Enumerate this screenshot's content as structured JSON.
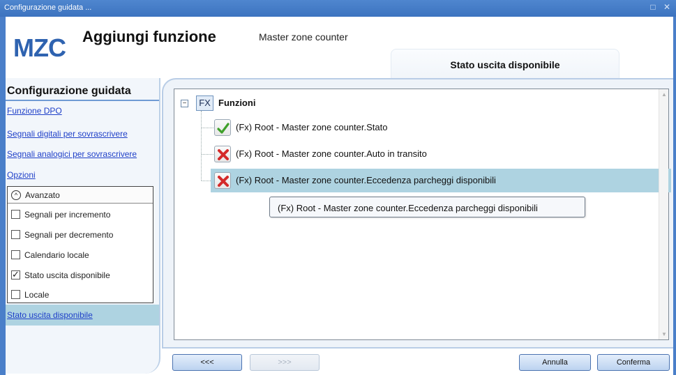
{
  "window": {
    "title": "Configurazione guidata ...",
    "controls": "□ ✕"
  },
  "header": {
    "logo": "MZC",
    "title": "Aggiungi funzione",
    "subtitle": "Master zone counter",
    "active_tab": "Stato uscita disponibile"
  },
  "sidebar": {
    "heading": "Configurazione guidata",
    "links": [
      "Funzione DPO",
      "Segnali digitali per sovrascrivere",
      "Segnali analogici per sovrascrivere",
      "Opzioni"
    ],
    "advanced": {
      "label": "Avanzato",
      "items": [
        {
          "label": "Segnali per incremento",
          "checked": false
        },
        {
          "label": "Segnali per decremento",
          "checked": false
        },
        {
          "label": "Calendario locale",
          "checked": false
        },
        {
          "label": "Stato uscita disponibile",
          "checked": true
        },
        {
          "label": "Locale",
          "checked": false
        }
      ]
    },
    "selected_link": "Stato uscita disponibile"
  },
  "tree": {
    "root_badge": "FX",
    "root_label": "Funzioni",
    "rows": [
      {
        "label": "(Fx) Root - Master zone counter.Stato",
        "status": "check-icon"
      },
      {
        "label": "(Fx) Root - Master zone counter.Auto in transito",
        "status": "cross-icon"
      },
      {
        "label": "(Fx) Root - Master zone counter.Eccedenza parcheggi disponibili",
        "status": "cross-icon"
      }
    ],
    "tooltip": "(Fx) Root - Master zone counter.Eccedenza parcheggi disponibili"
  },
  "buttons": {
    "back": "<<<",
    "forward": ">>>",
    "cancel": "Annulla",
    "confirm": "Conferma"
  }
}
